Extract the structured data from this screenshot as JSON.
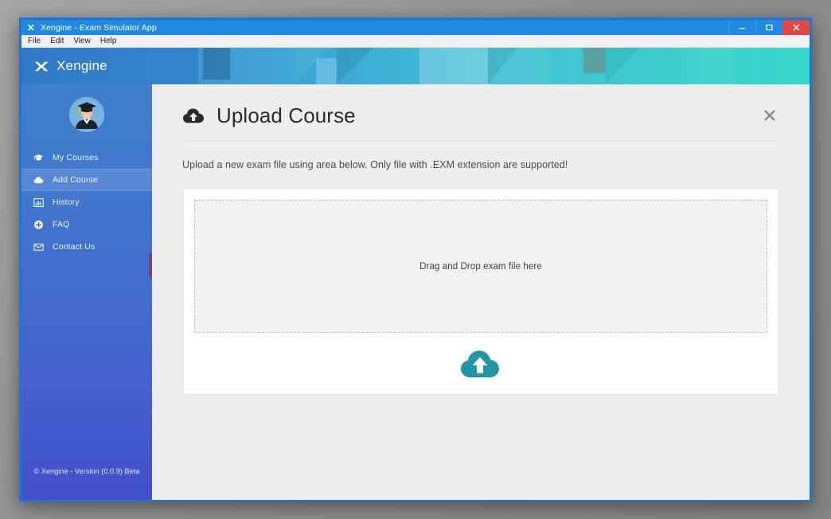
{
  "window": {
    "titlebar": {
      "title": "Xengine -  Exam Simulator App",
      "logo_icon": "xengine-logo-icon",
      "minimize_label": "–",
      "maximize_label": "□",
      "close_label": "✕"
    },
    "menubar": {
      "items": [
        {
          "label": "File"
        },
        {
          "label": "Edit"
        },
        {
          "label": "View"
        },
        {
          "label": "Help"
        }
      ]
    }
  },
  "brand": {
    "name": "Xengine",
    "logo_icon": "xengine-mark-icon"
  },
  "sidebar": {
    "avatar_icon": "graduate-avatar-icon",
    "items": [
      {
        "label": "My Courses",
        "icon": "graduation-cap-icon",
        "active": false
      },
      {
        "label": "Add Course",
        "icon": "cloud-icon",
        "active": true
      },
      {
        "label": "History",
        "icon": "bar-chart-icon",
        "active": false
      },
      {
        "label": "FAQ",
        "icon": "plus-circle-icon",
        "active": false
      },
      {
        "label": "Contact Us",
        "icon": "envelope-icon",
        "active": false
      }
    ],
    "footer": "© Xengine - Version (0.0.9) Beta"
  },
  "main": {
    "title": "Upload Course",
    "title_icon": "cloud-upload-icon",
    "close_icon": "close-icon",
    "description": "Upload a new exam file using area below. Only file with .EXM extension are supported!",
    "dropzone_text": "Drag and Drop exam file here",
    "upload_button_icon": "cloud-upload-button-icon"
  },
  "colors": {
    "titlebar": "#1f8ae0",
    "close_button": "#e04848",
    "sidebar_top": "#3f7fcf",
    "sidebar_bottom": "#4250cc",
    "header_gradient_start": "#2f79c6",
    "header_gradient_end": "#37d6cb",
    "accent_teal": "#2196a8",
    "page_background": "#eeeeee"
  }
}
